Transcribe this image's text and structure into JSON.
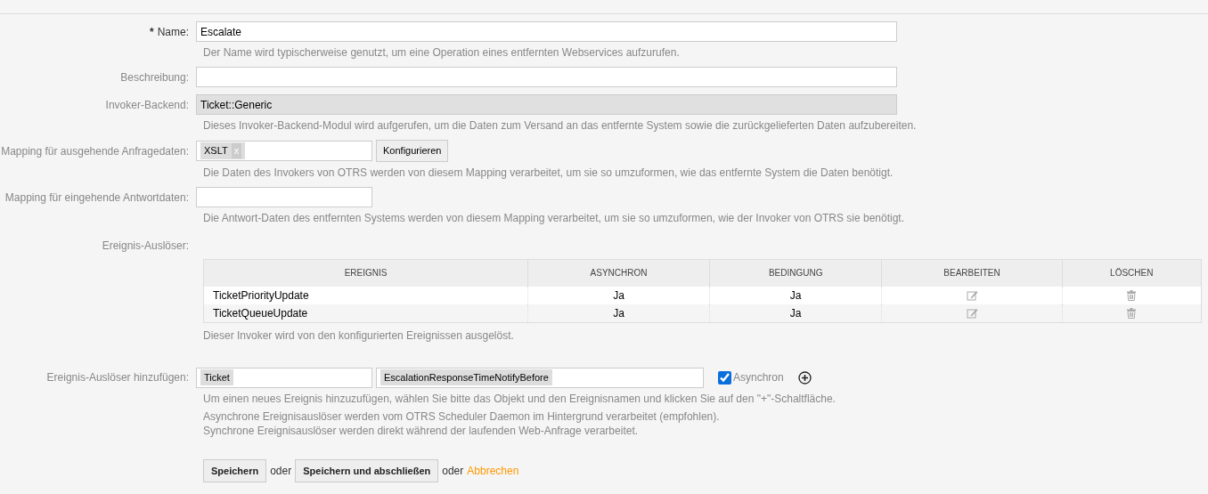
{
  "fields": [
    {
      "kind": "text",
      "label": "Name:",
      "required_mark": "*",
      "value": "Escalate",
      "help": [
        "Der Name wird typischerweise genutzt, um eine Operation eines entfernten Webservices aufzurufen."
      ]
    },
    {
      "kind": "text",
      "label": "Beschreibung:"
    },
    {
      "kind": "readonly",
      "label": "Invoker-Backend:",
      "value": "Ticket::Generic",
      "help": [
        "Dieses Invoker-Backend-Modul wird aufgerufen, um die Daten zum Versand an das entfernte System sowie die zurückgelieferten Daten aufzubereiten."
      ]
    },
    {
      "kind": "tags",
      "label": "Mapping für ausgehende Anfragedaten:",
      "tags": [
        {
          "text": "XSLT",
          "remove": "x"
        }
      ],
      "button": "Konfigurieren",
      "help": [
        "Die Daten des Invokers von OTRS werden von diesem Mapping verarbeitet, um sie so umzuformen, wie das entfernte System die Daten benötigt."
      ]
    },
    {
      "kind": "tags",
      "label": "Mapping für eingehende Antwortdaten:",
      "help": [
        "Die Antwort-Daten des entfernten Systems werden von diesem Mapping verarbeitet, um sie so umzuformen, wie der Invoker von OTRS sie benötigt."
      ]
    }
  ],
  "events": {
    "label": "Ereignis-Auslöser:",
    "columns": [
      "EREIGNIS",
      "ASYNCHRON",
      "BEDINGUNG",
      "BEARBEITEN",
      "LÖSCHEN"
    ],
    "rows": [
      {
        "event": "TicketPriorityUpdate",
        "asynchron": "Ja",
        "bedingung": "Ja"
      },
      {
        "event": "TicketQueueUpdate",
        "asynchron": "Ja",
        "bedingung": "Ja"
      }
    ],
    "help": "Dieser Invoker wird von den konfigurierten Ereignissen ausgelöst."
  },
  "add_event": {
    "label": "Ereignis-Auslöser hinzufügen:",
    "object": "Ticket",
    "event": "EscalationResponseTimeNotifyBefore",
    "async_label": "Asynchron",
    "async_checked": true,
    "help": [
      "Um einen neues Ereignis hinzuzufügen, wählen Sie bitte das Objekt und den Ereignisnamen und klicken Sie auf den \"+\"-Schaltfläche.",
      "Asynchrone Ereignisauslöser werden vom OTRS Scheduler Daemon im Hintergrund verarbeitet (empfohlen).\nSynchrone Ereignisauslöser werden direkt während der laufenden Web-Anfrage verarbeitet."
    ]
  },
  "actions": [
    {
      "kind": "button",
      "text": "Speichern"
    },
    {
      "kind": "text",
      "text": "oder"
    },
    {
      "kind": "button",
      "text": "Speichern und abschließen"
    },
    {
      "kind": "text",
      "text": "oder"
    },
    {
      "kind": "link",
      "text": "Abbrechen"
    }
  ]
}
